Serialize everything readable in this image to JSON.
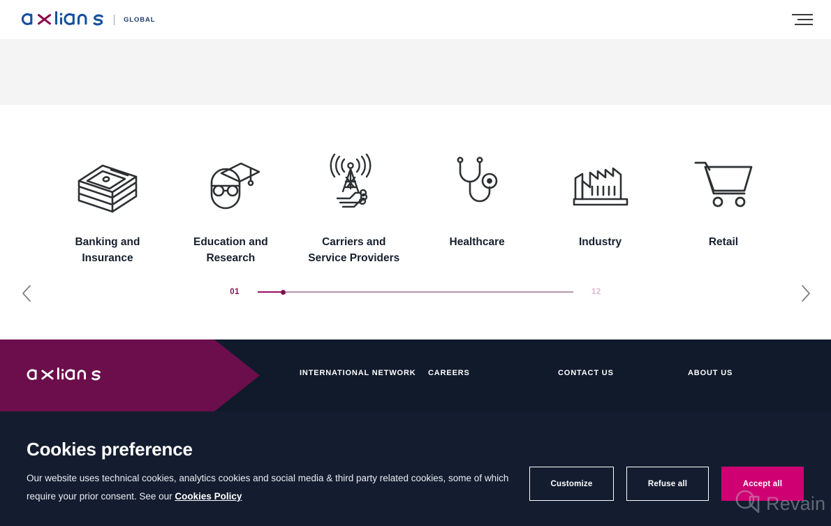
{
  "header": {
    "logo_text": "axians",
    "logo_name": "axians-logo",
    "global_label": "GLOBAL",
    "menu_icon": "hamburger-menu-icon"
  },
  "carousel": {
    "prev_icon": "chevron-left-icon",
    "next_icon": "chevron-right-icon",
    "sectors": [
      {
        "label": "Banking and\nInsurance",
        "line1": "Banking and",
        "line2": "Insurance",
        "icon": "banknotes-stack-icon"
      },
      {
        "label": "Education and\nResearch",
        "line1": "Education and",
        "line2": "Research",
        "icon": "graduate-student-icon"
      },
      {
        "label": "Carriers and\nService Providers",
        "line1": "Carriers and",
        "line2": "Service Providers",
        "icon": "radio-tower-network-icon"
      },
      {
        "label": "Healthcare",
        "line1": "Healthcare",
        "line2": "",
        "icon": "stethoscope-icon"
      },
      {
        "label": "Industry",
        "line1": "Industry",
        "line2": "",
        "icon": "factory-icon"
      },
      {
        "label": "Retail",
        "line1": "Retail",
        "line2": "",
        "icon": "shopping-cart-icon"
      }
    ],
    "progress": {
      "current": "01",
      "total": "12",
      "fill_percent": 8
    }
  },
  "footer": {
    "logo_text": "axians",
    "links": [
      {
        "label": "INTERNATIONAL NETWORK",
        "name": "footer-link-international-network"
      },
      {
        "label": "CAREERS",
        "name": "footer-link-careers"
      },
      {
        "label": "CONTACT US",
        "name": "footer-link-contact-us"
      },
      {
        "label": "ABOUT US",
        "name": "footer-link-about-us"
      }
    ]
  },
  "cookie_banner": {
    "title": "Cookies preference",
    "body_part1": "Our website uses technical cookies, analytics cookies and social media & third party related cookies, some of which require your prior consent. See our ",
    "policy_link": "Cookies Policy",
    "buttons": {
      "customize": "Customize",
      "refuse": "Refuse all",
      "accept": "Accept all"
    }
  },
  "watermark": {
    "text": "Revain",
    "icon": "revain-logo-icon"
  },
  "colors": {
    "brand_blue": "#15519e",
    "brand_magenta": "#8e0b4d",
    "footer_purple": "#6b0e4b",
    "footer_navy": "#101a2b",
    "banner_navy": "#141d2f",
    "accept_pink": "#cf0072",
    "progress_magenta": "#9b0f63",
    "grey_band": "#f4f4f5"
  }
}
